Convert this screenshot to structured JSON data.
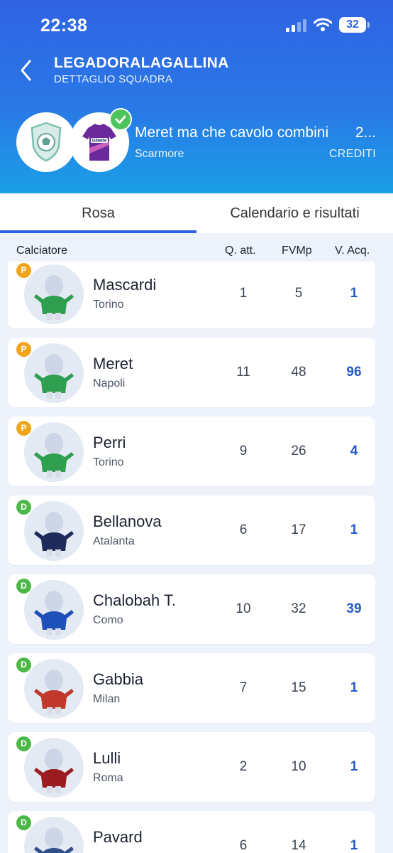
{
  "status": {
    "time": "22:38",
    "battery": "32"
  },
  "nav": {
    "title": "LEGADORALAGALLINA",
    "subtitle": "DETTAGLIO SQUADRA"
  },
  "team": {
    "name": "Meret ma che cavolo combini",
    "credits": "2...",
    "owner": "Scarmore",
    "credits_label": "CREDITI",
    "jersey_sponsor": "Gillette"
  },
  "tabs": [
    {
      "label": "Rosa",
      "active": true
    },
    {
      "label": "Calendario e risultati",
      "active": false
    }
  ],
  "columns": {
    "player": "Calciatore",
    "q": "Q. att.",
    "fvm": "FVMp",
    "v": "V. Acq."
  },
  "colors": {
    "accent": "#2f63e2",
    "goalkeeper": "#f0a51c",
    "defender": "#4cb847",
    "value": "#2459c9"
  },
  "players": [
    {
      "role": "P",
      "name": "Mascardi",
      "team": "Torino",
      "q": "1",
      "fvm": "5",
      "v": "1",
      "kit": "#2e9e4f"
    },
    {
      "role": "P",
      "name": "Meret",
      "team": "Napoli",
      "q": "11",
      "fvm": "48",
      "v": "96",
      "kit": "#2e9e4f"
    },
    {
      "role": "P",
      "name": "Perri",
      "team": "Torino",
      "q": "9",
      "fvm": "26",
      "v": "4",
      "kit": "#2e9e4f"
    },
    {
      "role": "D",
      "name": "Bellanova",
      "team": "Atalanta",
      "q": "6",
      "fvm": "17",
      "v": "1",
      "kit": "#1d2a5a"
    },
    {
      "role": "D",
      "name": "Chalobah T.",
      "team": "Como",
      "q": "10",
      "fvm": "32",
      "v": "39",
      "kit": "#1f4fb8"
    },
    {
      "role": "D",
      "name": "Gabbia",
      "team": "Milan",
      "q": "7",
      "fvm": "15",
      "v": "1",
      "kit": "#c0392b"
    },
    {
      "role": "D",
      "name": "Lulli",
      "team": "Roma",
      "q": "2",
      "fvm": "10",
      "v": "1",
      "kit": "#9b1d20"
    },
    {
      "role": "D",
      "name": "Pavard",
      "team": "",
      "q": "6",
      "fvm": "14",
      "v": "1",
      "kit": "#2f4f8a"
    }
  ]
}
